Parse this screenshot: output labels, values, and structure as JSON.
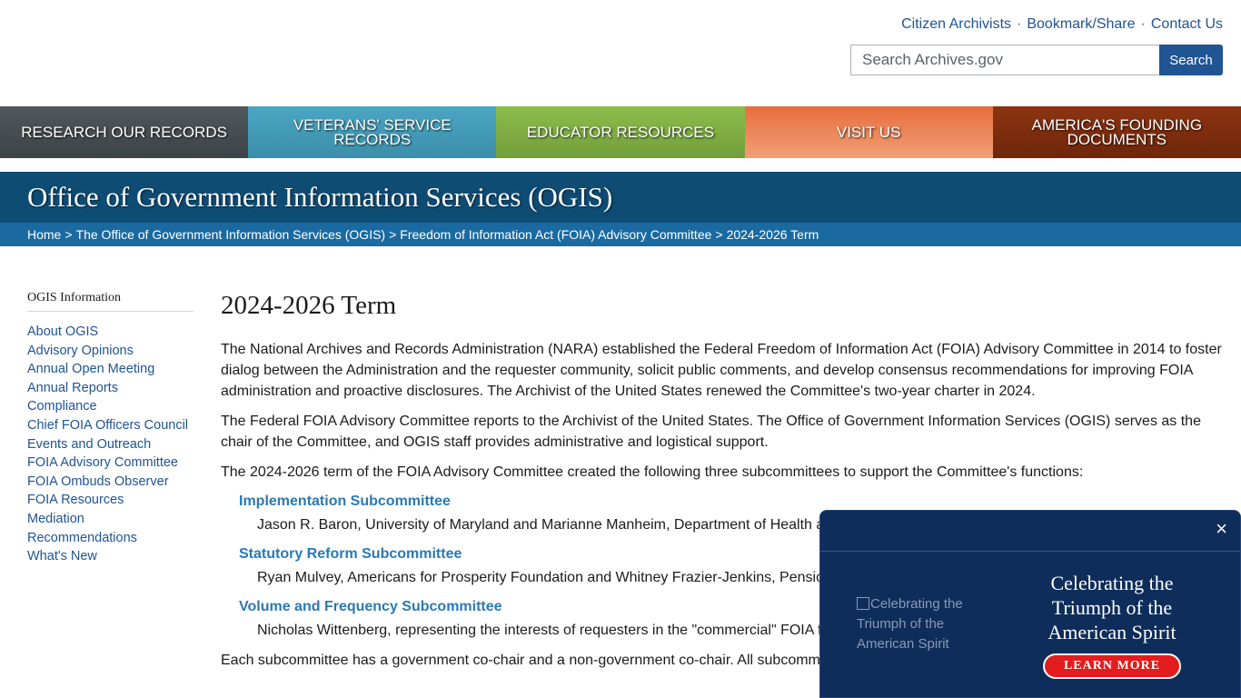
{
  "utility": {
    "links": [
      "Citizen Archivists",
      "Bookmark/Share",
      "Contact Us"
    ],
    "separator": "·"
  },
  "search": {
    "placeholder": "Search Archives.gov",
    "button": "Search"
  },
  "mainnav": [
    "RESEARCH OUR RECORDS",
    "VETERANS' SERVICE RECORDS",
    "EDUCATOR RESOURCES",
    "VISIT US",
    "AMERICA'S FOUNDING DOCUMENTS"
  ],
  "page": {
    "section_title": "Office of Government Information Services (OGIS)",
    "breadcrumb": [
      "Home",
      "The Office of Government Information Services (OGIS)",
      "Freedom of Information Act (FOIA) Advisory Committee",
      "2024-2026 Term"
    ],
    "breadcrumb_sep": ">"
  },
  "sidebar": {
    "heading": "OGIS Information",
    "items": [
      "About OGIS",
      "Advisory Opinions",
      "Annual Open Meeting",
      "Annual Reports",
      "Compliance",
      "Chief FOIA Officers Council",
      "Events and Outreach",
      "FOIA Advisory Committee",
      "FOIA Ombuds Observer",
      "FOIA Resources",
      "Mediation",
      "Recommendations",
      "What's New"
    ]
  },
  "content": {
    "title": "2024-2026 Term",
    "paragraphs": [
      "The National Archives and Records Administration (NARA) established the Federal Freedom of Information Act (FOIA) Advisory Committee in 2014 to foster dialog between the Administration and the requester community, solicit public comments, and develop consensus recommendations for improving FOIA administration and proactive disclosures. The Archivist of the United States renewed the Committee's two-year charter in 2024.",
      "The Federal FOIA Advisory Committee reports to the Archivist of the United States. The Office of Government Information Services (OGIS) serves as the chair of the Committee, and OGIS staff provides administrative and logistical support.",
      "The 2024-2026 term of the FOIA Advisory Committee created the following three subcommittees to support the Committee's functions:"
    ],
    "subcommittees": [
      {
        "name": "Implementation Subcommittee",
        "members": "Jason R. Baron, University of Maryland and Marianne Manheim, Department of Health a"
      },
      {
        "name": "Statutory Reform Subcommittee",
        "members": "Ryan Mulvey, Americans for Prosperity Foundation and Whitney Frazier-Jenkins, Pensio"
      },
      {
        "name": "Volume and Frequency Subcommittee",
        "members": "Nicholas Wittenberg, representing the interests of requesters in the \"commercial\" FOIA f Defense Intelligence Agency"
      }
    ],
    "closing": "Each subcommittee has a government co-chair and a non-government co-chair. All subcomm"
  },
  "popup": {
    "close": "×",
    "image_alt": "Celebrating the Triumph of the American Spirit",
    "title": "Celebrating the Triumph of the American Spirit",
    "button": "LEARN MORE"
  },
  "colors": {
    "brand_blue": "#0e4c74",
    "breadcrumb_blue": "#1a6aa1",
    "link": "#205493",
    "popup_bg": "#0e2d5a",
    "cta_red": "#e31d1d"
  }
}
